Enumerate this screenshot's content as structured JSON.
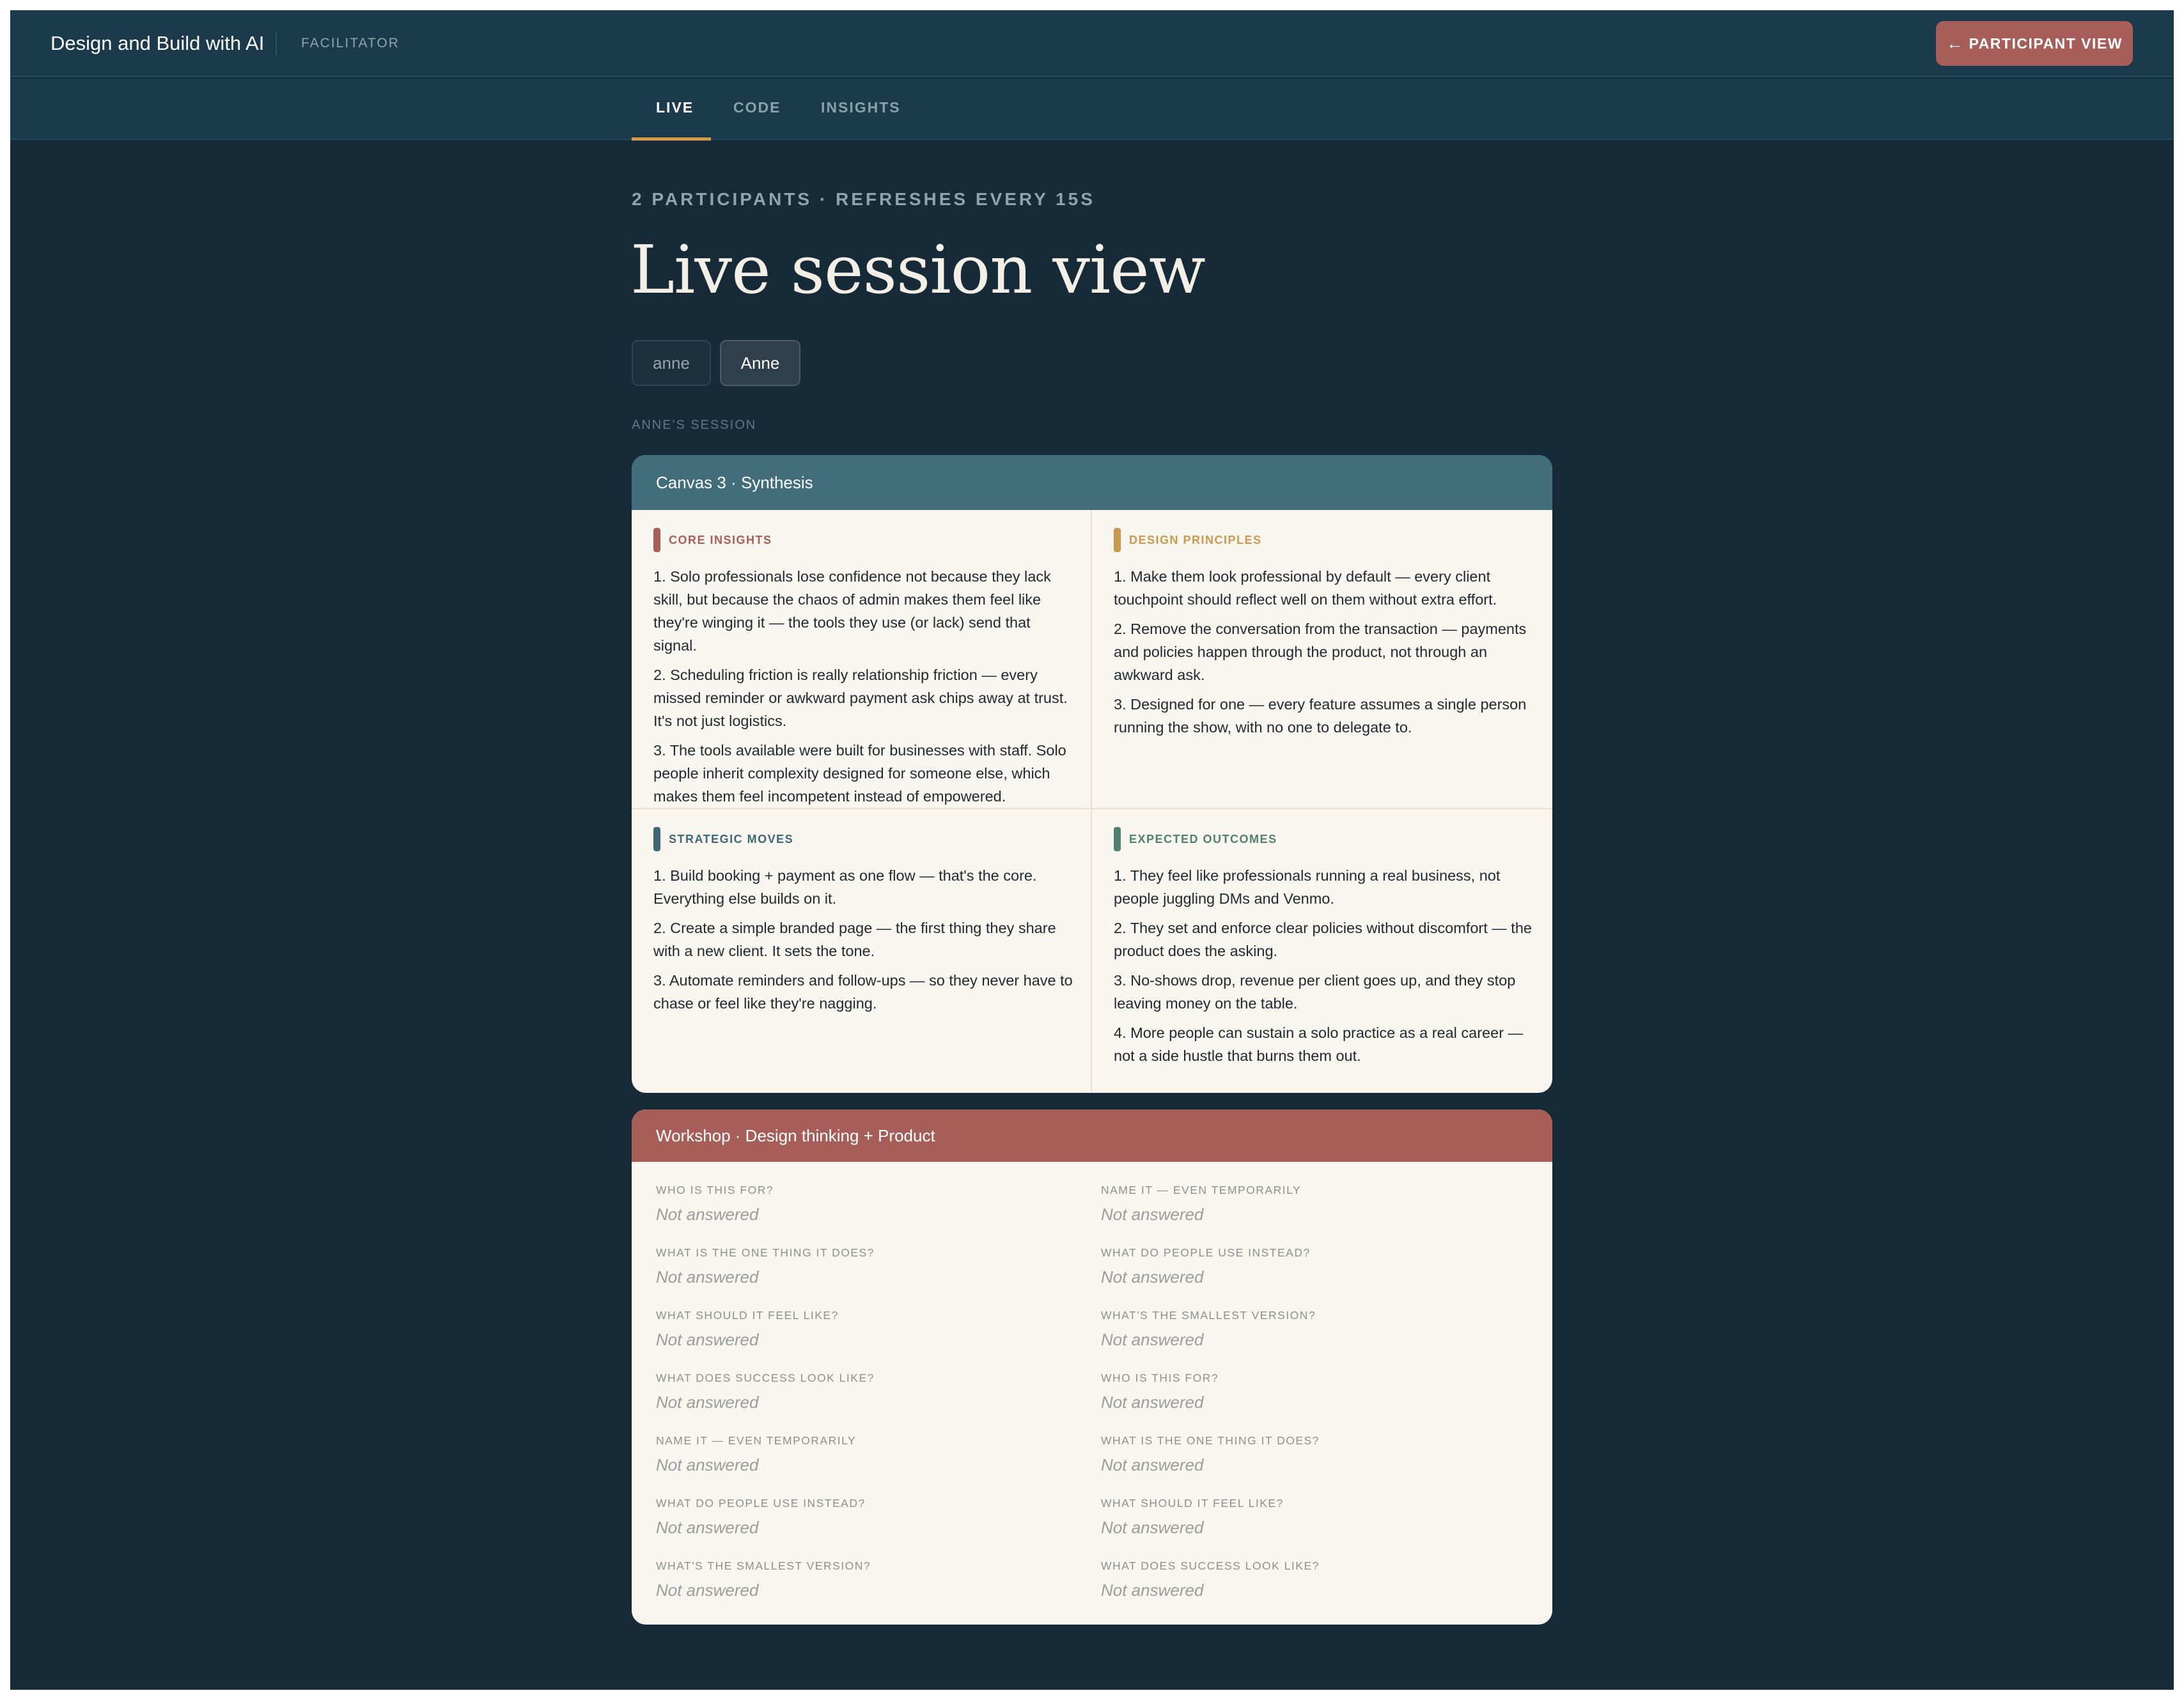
{
  "header": {
    "brand": "Design and Build with AI",
    "role": "FACILITATOR",
    "participant_view": "PARTICIPANT VIEW",
    "participant_view_arrow": "←"
  },
  "tabs": [
    {
      "label": "LIVE",
      "active": true
    },
    {
      "label": "CODE",
      "active": false
    },
    {
      "label": "INSIGHTS",
      "active": false
    }
  ],
  "page": {
    "meta": "2 PARTICIPANTS · REFRESHES EVERY 15S",
    "title": "Live session view",
    "participants": [
      "anne",
      "Anne"
    ],
    "session_label": "ANNE'S SESSION"
  },
  "canvas": {
    "title": "Canvas 3 · Synthesis",
    "quadrants": [
      {
        "label": "CORE INSIGHTS",
        "color": "#a85e58",
        "items": [
          "1. Solo professionals lose confidence not because they lack skill, but because the chaos of admin makes them feel like they're winging it — the tools they use (or lack) send that signal.",
          "2. Scheduling friction is really relationship friction — every missed reminder or awkward payment ask chips away at trust. It's not just logistics.",
          "3. The tools available were built for businesses with staff. Solo people inherit complexity designed for someone else, which makes them feel incompetent instead of empowered."
        ]
      },
      {
        "label": "DESIGN PRINCIPLES",
        "color": "#c99a4e",
        "items": [
          "1. Make them look professional by default — every client touchpoint should reflect well on them without extra effort.",
          "2. Remove the conversation from the transaction — payments and policies happen through the product, not through an awkward ask.",
          "3. Designed for one — every feature assumes a single person running the show, with no one to delegate to."
        ]
      },
      {
        "label": "STRATEGIC MOVES",
        "color": "#3c6878",
        "items": [
          "1. Build booking + payment as one flow — that's the core. Everything else builds on it.",
          "2. Create a simple branded page — the first thing they share with a new client. It sets the tone.",
          "3. Automate reminders and follow-ups — so they never have to chase or feel like they're nagging."
        ]
      },
      {
        "label": "EXPECTED OUTCOMES",
        "color": "#4e8170",
        "items": [
          "1. They feel like professionals running a real business, not people juggling DMs and Venmo.",
          "2. They set and enforce clear policies without discomfort — the product does the asking.",
          "3. No-shows drop, revenue per client goes up, and they stop leaving money on the table.",
          "4. More people can sustain a solo practice as a real career — not a side hustle that burns them out."
        ]
      }
    ]
  },
  "workshop": {
    "title": "Workshop · Design thinking + Product",
    "left": [
      {
        "q": "WHO IS THIS FOR?",
        "a": "Not answered"
      },
      {
        "q": "WHAT IS THE ONE THING IT DOES?",
        "a": "Not answered"
      },
      {
        "q": "WHAT SHOULD IT FEEL LIKE?",
        "a": "Not answered"
      },
      {
        "q": "WHAT DOES SUCCESS LOOK LIKE?",
        "a": "Not answered"
      },
      {
        "q": "NAME IT — EVEN TEMPORARILY",
        "a": "Not answered"
      },
      {
        "q": "WHAT DO PEOPLE USE INSTEAD?",
        "a": "Not answered"
      },
      {
        "q": "WHAT'S THE SMALLEST VERSION?",
        "a": "Not answered"
      }
    ],
    "right": [
      {
        "q": "NAME IT — EVEN TEMPORARILY",
        "a": "Not answered"
      },
      {
        "q": "WHAT DO PEOPLE USE INSTEAD?",
        "a": "Not answered"
      },
      {
        "q": "WHAT'S THE SMALLEST VERSION?",
        "a": "Not answered"
      },
      {
        "q": "WHO IS THIS FOR?",
        "a": "Not answered"
      },
      {
        "q": "WHAT IS THE ONE THING IT DOES?",
        "a": "Not answered"
      },
      {
        "q": "WHAT SHOULD IT FEEL LIKE?",
        "a": "Not answered"
      },
      {
        "q": "WHAT DOES SUCCESS LOOK LIKE?",
        "a": "Not answered"
      }
    ]
  }
}
